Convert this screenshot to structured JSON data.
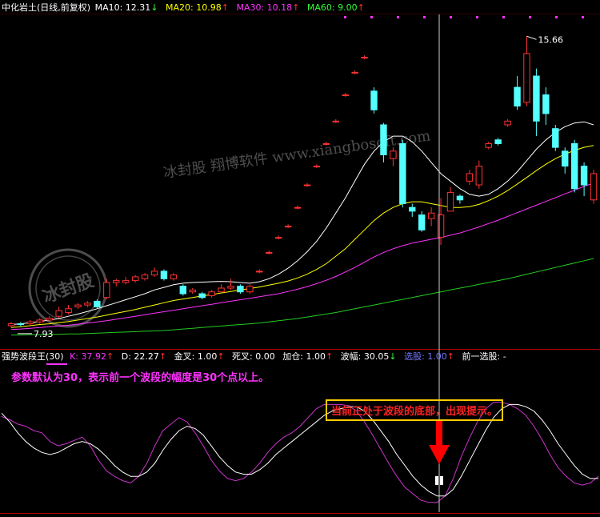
{
  "colors": {
    "background": "#000000",
    "up": "#ff3232",
    "down": "#54ffff",
    "frame": "#b00000",
    "ma10": "#ffffff",
    "ma20": "#ffff00",
    "ma30": "#ff33ff",
    "ma60": "#22cc22",
    "osc_line1": "#ffffff",
    "osc_line2": "#cc33cc",
    "cursor": "#cccccc",
    "annotation_text": "#ff33ff",
    "callout_text": "#ff2222",
    "callout_border": "#ffcc00",
    "arrow": "#ff0000",
    "watermark": "#dddddd"
  },
  "header": {
    "stock": "中化岩土(日线,前复权)",
    "ma10_label": "MA10: 12.31",
    "ma10_arrow": "↓",
    "ma20_label": "MA20: 10.98",
    "ma20_arrow": "↑",
    "ma30_label": "MA30: 10.18",
    "ma30_arrow": "↑",
    "ma60_label": "MA60: 9.00",
    "ma60_arrow": "↑"
  },
  "indicator_header": {
    "name": "强势波段王(30)",
    "k": "K: 37.92",
    "k_arrow": "↑",
    "d": "D: 22.27",
    "d_arrow": "↑",
    "golden_cross": "金叉: 1.00",
    "golden_arrow": "↑",
    "dead_cross": "死叉: 0.00",
    "add_position": "加仓: 1.00",
    "add_arrow": "↑",
    "amplitude": "波幅: 30.05",
    "amplitude_arrow": "↓",
    "select": "选股: 1.00",
    "select_arrow": "↑",
    "prev_select": "前一选股: -"
  },
  "annotations": {
    "param_note": "参数默认为30，表示前一个波段的幅度是30个点以上。",
    "callout": "当前正处于波段的底部，出现提示。",
    "high_label": "15.66",
    "low_label": "7.93",
    "watermark_brand": "冰封股    翔博软件  www.xiangbosoft.com",
    "watermark_seal": "冰封股"
  },
  "chart_data": [
    {
      "type": "candlestick",
      "title": "中化岩土(日线,前复权)",
      "ylim": [
        7.5,
        16.2
      ],
      "high_mark": 15.66,
      "low_mark": 7.93,
      "candles": [
        [
          7.95,
          8.0,
          8.05,
          7.9
        ],
        [
          8.0,
          7.98,
          8.05,
          7.93
        ],
        [
          8.0,
          8.05,
          8.1,
          7.95
        ],
        [
          8.05,
          8.1,
          8.15,
          8.0
        ],
        [
          8.1,
          8.15,
          8.2,
          8.05
        ],
        [
          8.2,
          8.35,
          8.45,
          8.15
        ],
        [
          8.3,
          8.4,
          8.5,
          8.25
        ],
        [
          8.45,
          8.5,
          8.55,
          8.4
        ],
        [
          8.5,
          8.55,
          8.6,
          8.45
        ],
        [
          8.6,
          8.45,
          8.65,
          8.4
        ],
        [
          8.7,
          9.1,
          9.2,
          8.65
        ],
        [
          9.1,
          9.15,
          9.2,
          9.0
        ],
        [
          9.1,
          9.15,
          9.25,
          9.05
        ],
        [
          9.15,
          9.25,
          9.3,
          9.1
        ],
        [
          9.2,
          9.3,
          9.35,
          9.15
        ],
        [
          9.3,
          9.4,
          9.5,
          9.25
        ],
        [
          9.4,
          9.2,
          9.45,
          9.15
        ],
        [
          9.2,
          9.3,
          9.35,
          9.15
        ],
        [
          9.0,
          8.8,
          9.05,
          8.75
        ],
        [
          8.85,
          8.9,
          8.95,
          8.8
        ],
        [
          8.8,
          8.7,
          8.85,
          8.65
        ],
        [
          8.75,
          8.85,
          8.9,
          8.7
        ],
        [
          8.85,
          8.95,
          9.05,
          8.8
        ],
        [
          8.95,
          9.0,
          9.2,
          8.9
        ],
        [
          9.0,
          8.85,
          9.05,
          8.8
        ],
        [
          8.85,
          9.0,
          9.05,
          8.8
        ],
        [
          9.4,
          9.4,
          9.45,
          9.35
        ],
        [
          9.9,
          9.9,
          9.95,
          9.85
        ],
        [
          10.3,
          10.3,
          10.35,
          10.25
        ],
        [
          10.6,
          10.6,
          10.65,
          10.55
        ],
        [
          11.1,
          11.1,
          11.15,
          11.05
        ],
        [
          11.7,
          11.7,
          11.75,
          11.65
        ],
        [
          12.2,
          12.2,
          12.25,
          12.15
        ],
        [
          12.8,
          12.8,
          12.85,
          12.75
        ],
        [
          13.4,
          13.4,
          13.45,
          13.35
        ],
        [
          14.1,
          14.1,
          14.15,
          14.05
        ],
        [
          14.7,
          14.7,
          14.75,
          14.65
        ],
        [
          15.1,
          15.1,
          15.15,
          15.05
        ],
        [
          14.2,
          13.7,
          14.3,
          13.6
        ],
        [
          13.3,
          12.5,
          13.35,
          12.3
        ],
        [
          12.4,
          12.6,
          12.7,
          12.2
        ],
        [
          12.8,
          11.2,
          12.9,
          11.1
        ],
        [
          11.1,
          11.0,
          11.2,
          10.85
        ],
        [
          10.9,
          10.5,
          11.0,
          10.45
        ],
        [
          10.8,
          10.95,
          11.1,
          10.6
        ],
        [
          10.3,
          10.9,
          11.35,
          10.1
        ],
        [
          11.0,
          11.5,
          11.65,
          11.0
        ],
        [
          11.4,
          11.3,
          11.45,
          11.2
        ],
        [
          11.8,
          12.0,
          12.1,
          11.7
        ],
        [
          11.7,
          12.2,
          12.35,
          11.6
        ],
        [
          12.7,
          12.8,
          12.85,
          12.65
        ],
        [
          12.9,
          12.8,
          12.95,
          12.75
        ],
        [
          13.3,
          13.4,
          13.45,
          13.25
        ],
        [
          14.3,
          13.8,
          14.6,
          13.7
        ],
        [
          13.9,
          15.2,
          15.66,
          13.8
        ],
        [
          14.6,
          13.4,
          14.8,
          13.0
        ],
        [
          14.1,
          13.6,
          14.3,
          13.3
        ],
        [
          13.2,
          12.7,
          13.3,
          12.6
        ],
        [
          12.6,
          12.2,
          12.7,
          12.0
        ],
        [
          12.8,
          11.6,
          12.9,
          11.5
        ],
        [
          12.2,
          11.7,
          12.3,
          11.4
        ],
        [
          11.3,
          12.0,
          12.1,
          11.2
        ]
      ],
      "series": [
        {
          "name": "MA10",
          "values": [
            7.98,
            8.0,
            8.03,
            8.06,
            8.1,
            8.14,
            8.2,
            8.26,
            8.33,
            8.4,
            8.48,
            8.56,
            8.64,
            8.72,
            8.8,
            8.9,
            8.97,
            9.04,
            9.08,
            9.1,
            9.11,
            9.12,
            9.13,
            9.12,
            9.1,
            9.08,
            9.12,
            9.2,
            9.32,
            9.48,
            9.68,
            9.92,
            10.2,
            10.55,
            10.95,
            11.35,
            11.8,
            12.25,
            12.6,
            12.85,
            13.0,
            13.0,
            12.85,
            12.6,
            12.3,
            12.0,
            11.8,
            11.6,
            11.45,
            11.4,
            11.45,
            11.6,
            11.8,
            12.05,
            12.35,
            12.65,
            12.9,
            13.1,
            13.25,
            13.35,
            13.38,
            13.3
          ]
        },
        {
          "name": "MA20",
          "values": [
            7.9,
            7.92,
            7.95,
            7.98,
            8.0,
            8.03,
            8.06,
            8.1,
            8.14,
            8.18,
            8.23,
            8.28,
            8.33,
            8.38,
            8.44,
            8.5,
            8.56,
            8.62,
            8.66,
            8.7,
            8.74,
            8.78,
            8.82,
            8.86,
            8.9,
            8.94,
            8.98,
            9.03,
            9.08,
            9.14,
            9.22,
            9.32,
            9.45,
            9.6,
            9.8,
            10.0,
            10.25,
            10.5,
            10.75,
            10.95,
            11.1,
            11.2,
            11.25,
            11.25,
            11.2,
            11.15,
            11.1,
            11.1,
            11.12,
            11.18,
            11.28,
            11.4,
            11.55,
            11.72,
            11.9,
            12.08,
            12.25,
            12.4,
            12.52,
            12.62,
            12.7,
            12.75
          ]
        },
        {
          "name": "MA30",
          "values": [
            7.85,
            7.86,
            7.88,
            7.9,
            7.92,
            7.94,
            7.96,
            7.99,
            8.02,
            8.05,
            8.08,
            8.12,
            8.16,
            8.2,
            8.24,
            8.28,
            8.32,
            8.36,
            8.4,
            8.44,
            8.48,
            8.52,
            8.56,
            8.6,
            8.64,
            8.68,
            8.72,
            8.76,
            8.8,
            8.86,
            8.92,
            8.99,
            9.07,
            9.16,
            9.26,
            9.38,
            9.5,
            9.64,
            9.78,
            9.9,
            10.0,
            10.08,
            10.15,
            10.2,
            10.25,
            10.3,
            10.36,
            10.42,
            10.5,
            10.58,
            10.67,
            10.76,
            10.86,
            10.96,
            11.06,
            11.16,
            11.26,
            11.36,
            11.46,
            11.56,
            11.66,
            11.75
          ]
        },
        {
          "name": "MA60",
          "values": [
            7.7,
            7.7,
            7.71,
            7.71,
            7.72,
            7.72,
            7.73,
            7.73,
            7.74,
            7.75,
            7.76,
            7.77,
            7.78,
            7.79,
            7.8,
            7.81,
            7.82,
            7.84,
            7.86,
            7.88,
            7.9,
            7.92,
            7.94,
            7.96,
            7.98,
            8.0,
            8.02,
            8.05,
            8.08,
            8.11,
            8.14,
            8.18,
            8.22,
            8.26,
            8.3,
            8.35,
            8.4,
            8.45,
            8.5,
            8.55,
            8.6,
            8.65,
            8.7,
            8.75,
            8.8,
            8.85,
            8.9,
            8.95,
            9.0,
            9.05,
            9.1,
            9.15,
            9.2,
            9.26,
            9.32,
            9.38,
            9.44,
            9.5,
            9.56,
            9.62,
            9.68,
            9.74
          ]
        }
      ]
    },
    {
      "type": "line",
      "title": "强势波段王(30)",
      "ylim": [
        0,
        100
      ],
      "series": [
        {
          "name": "K",
          "values": [
            85,
            82,
            78,
            76,
            72,
            70,
            62,
            58,
            60,
            63,
            66,
            58,
            45,
            35,
            30,
            26,
            24,
            30,
            42,
            58,
            72,
            78,
            84,
            80,
            70,
            58,
            45,
            35,
            28,
            26,
            28,
            34,
            42,
            52,
            60,
            66,
            70,
            76,
            84,
            92,
            96,
            96,
            96,
            95,
            90,
            80,
            68,
            55,
            42,
            30,
            20,
            14,
            8,
            6,
            6,
            12,
            28,
            48,
            65,
            80,
            92,
            98,
            98,
            96,
            92,
            86,
            76,
            64,
            50,
            38,
            30,
            24,
            22,
            24,
            30
          ]
        },
        {
          "name": "D",
          "values": [
            88,
            80,
            70,
            62,
            56,
            52,
            50,
            52,
            56,
            60,
            62,
            60,
            55,
            48,
            40,
            34,
            30,
            30,
            34,
            42,
            54,
            64,
            72,
            76,
            74,
            68,
            58,
            48,
            40,
            34,
            32,
            32,
            36,
            42,
            50,
            56,
            62,
            68,
            74,
            80,
            86,
            90,
            92,
            94,
            94,
            90,
            82,
            72,
            62,
            50,
            40,
            30,
            22,
            16,
            12,
            12,
            18,
            30,
            44,
            58,
            72,
            84,
            92,
            96,
            96,
            94,
            90,
            82,
            72,
            60,
            50,
            40,
            32,
            28,
            28
          ]
        }
      ]
    }
  ]
}
